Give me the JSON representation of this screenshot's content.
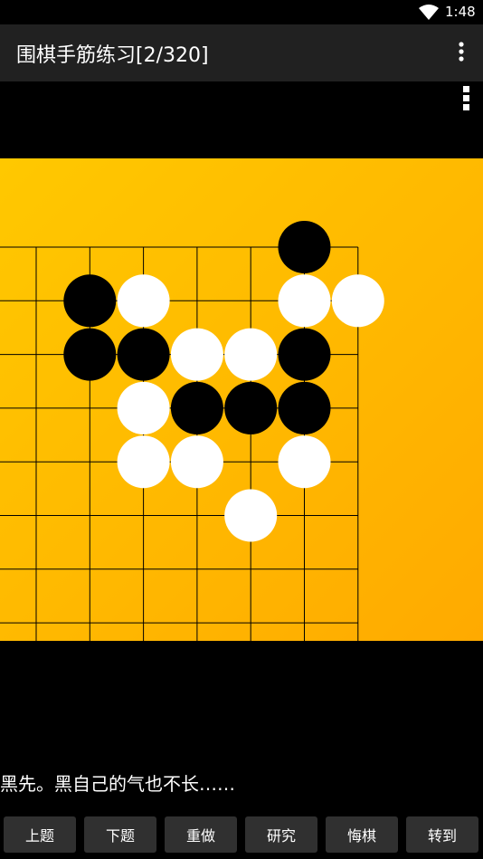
{
  "status_bar": {
    "time": "1:48",
    "wifi_icon": "wifi-icon"
  },
  "app_bar": {
    "title": "围棋手筋练习[2/320]",
    "menu_icon": "more-vert-icon"
  },
  "board": {
    "menu_icon": "more-vert-icon",
    "colors": {
      "board": "#FFBC00",
      "black_stone": "#000000",
      "white_stone": "#FFFFFF",
      "grid_line": "#000000"
    },
    "black_stones": [
      [
        5,
        0
      ],
      [
        1,
        1
      ],
      [
        1,
        2
      ],
      [
        2,
        2
      ],
      [
        5,
        2
      ],
      [
        3,
        3
      ],
      [
        4,
        3
      ],
      [
        5,
        3
      ]
    ],
    "white_stones": [
      [
        2,
        1
      ],
      [
        5,
        1
      ],
      [
        6,
        1
      ],
      [
        3,
        2
      ],
      [
        4,
        2
      ],
      [
        2,
        3
      ],
      [
        2,
        4
      ],
      [
        3,
        4
      ],
      [
        5,
        4
      ],
      [
        4,
        5
      ]
    ]
  },
  "problem_text": "黑先。黑自己的气也不长……",
  "buttons": [
    {
      "id": "prev",
      "label": "上题"
    },
    {
      "id": "next",
      "label": "下题"
    },
    {
      "id": "redo",
      "label": "重做"
    },
    {
      "id": "study",
      "label": "研究"
    },
    {
      "id": "undo",
      "label": "悔棋"
    },
    {
      "id": "goto",
      "label": "转到"
    }
  ]
}
